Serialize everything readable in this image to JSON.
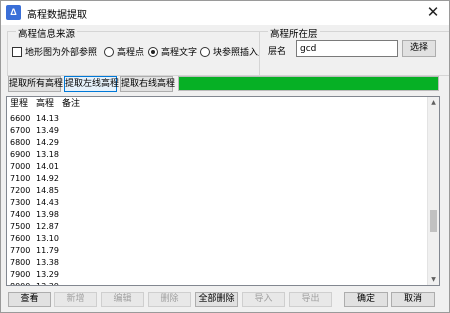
{
  "window": {
    "title": "高程数据提取",
    "icon": "app-logo-icon",
    "close_glyph": "✕"
  },
  "source_group": {
    "title": "高程信息来源",
    "xref_checkbox": {
      "label": "地形图为外部参照",
      "checked": false
    },
    "radios": [
      {
        "label": "高程点",
        "selected": false
      },
      {
        "label": "高程文字",
        "selected": true
      },
      {
        "label": "块参照插入点",
        "selected": false
      }
    ]
  },
  "layer_group": {
    "title": "高程所在层",
    "layer_label": "层名",
    "layer_value": "gcd",
    "select_button": "选择"
  },
  "extract_buttons": {
    "all": "提取所有高程",
    "left": "提取左线高程",
    "right": "提取右线高程"
  },
  "progress": {
    "value": 1.0,
    "color": "#06b025"
  },
  "table": {
    "columns": [
      "里程",
      "高程",
      "备注"
    ],
    "rows": [
      [
        "6600",
        "14.13",
        ""
      ],
      [
        "6700",
        "13.49",
        ""
      ],
      [
        "6800",
        "14.29",
        ""
      ],
      [
        "6900",
        "13.18",
        ""
      ],
      [
        "7000",
        "14.01",
        ""
      ],
      [
        "7100",
        "14.92",
        ""
      ],
      [
        "7200",
        "14.85",
        ""
      ],
      [
        "7300",
        "14.43",
        ""
      ],
      [
        "7400",
        "13.98",
        ""
      ],
      [
        "7500",
        "12.87",
        ""
      ],
      [
        "7600",
        "13.10",
        ""
      ],
      [
        "7700",
        "11.79",
        ""
      ],
      [
        "7800",
        "13.38",
        ""
      ],
      [
        "7900",
        "13.29",
        ""
      ],
      [
        "8000",
        "13.39",
        ""
      ],
      [
        "8100",
        "13.77",
        ""
      ],
      [
        "8200",
        "14.41",
        ""
      ]
    ]
  },
  "bottom_buttons": [
    {
      "label": "查看",
      "enabled": true
    },
    {
      "label": "新增",
      "enabled": false
    },
    {
      "label": "编辑",
      "enabled": false
    },
    {
      "label": "删除",
      "enabled": false
    },
    {
      "label": "全部删除",
      "enabled": true
    },
    {
      "label": "导入",
      "enabled": false
    },
    {
      "label": "导出",
      "enabled": false
    },
    {
      "label": "确定",
      "enabled": true
    },
    {
      "label": "取消",
      "enabled": true
    }
  ]
}
